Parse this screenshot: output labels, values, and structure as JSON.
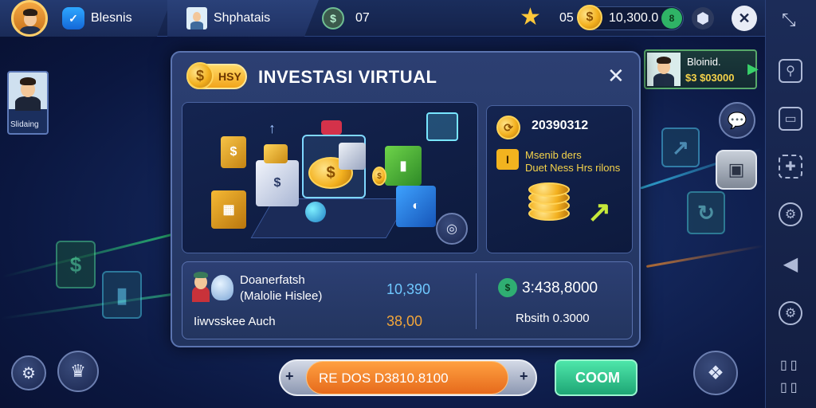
{
  "topbar": {
    "player_name": "Blesnis",
    "tab2_label": "Shphatais",
    "counter_value": "07",
    "star_count": "05",
    "coin_balance": "10,300.0",
    "balance_badge": "8"
  },
  "left_profile": {
    "label": "Slidaing"
  },
  "right_profile": {
    "name": "Bloinid.",
    "amount": "$3 $03000"
  },
  "modal": {
    "badge_label": "HSY",
    "title": "INVESTASI VIRTUAL",
    "close_icon": "close-icon",
    "stats_value": "20390312",
    "info_line1": "Msenib ders",
    "info_line2": "Duet Ness Hrs rilons",
    "info_prefix": "I",
    "row1_label": "Doanerfatsh",
    "row1_sub": "(Malolie Hislee)",
    "row1_value": "10,390",
    "row2_label": "Iiwvsskee Auch",
    "row2_value": "38,00",
    "right_value": "3:438,8000",
    "right_label": "Rbsith 0.3000"
  },
  "bottom": {
    "invest_label": "RE DOS D3810.8100",
    "minus_label": "+",
    "plus_label": "+",
    "confirm_label": "COOM"
  },
  "colors": {
    "accent_orange": "#f0782a",
    "accent_green": "#2fc58e",
    "gold": "#f6b41f",
    "modal_bg": "#2c3f72"
  },
  "icons": [
    "verified-shield-icon",
    "star-icon",
    "coin-icon",
    "settings-icon",
    "close-icon",
    "expand-icon",
    "chat-icon",
    "calendar-icon",
    "puzzle-icon",
    "gear-icon",
    "megaphone-icon",
    "chest-icon",
    "map-icon",
    "trophy-icon"
  ]
}
